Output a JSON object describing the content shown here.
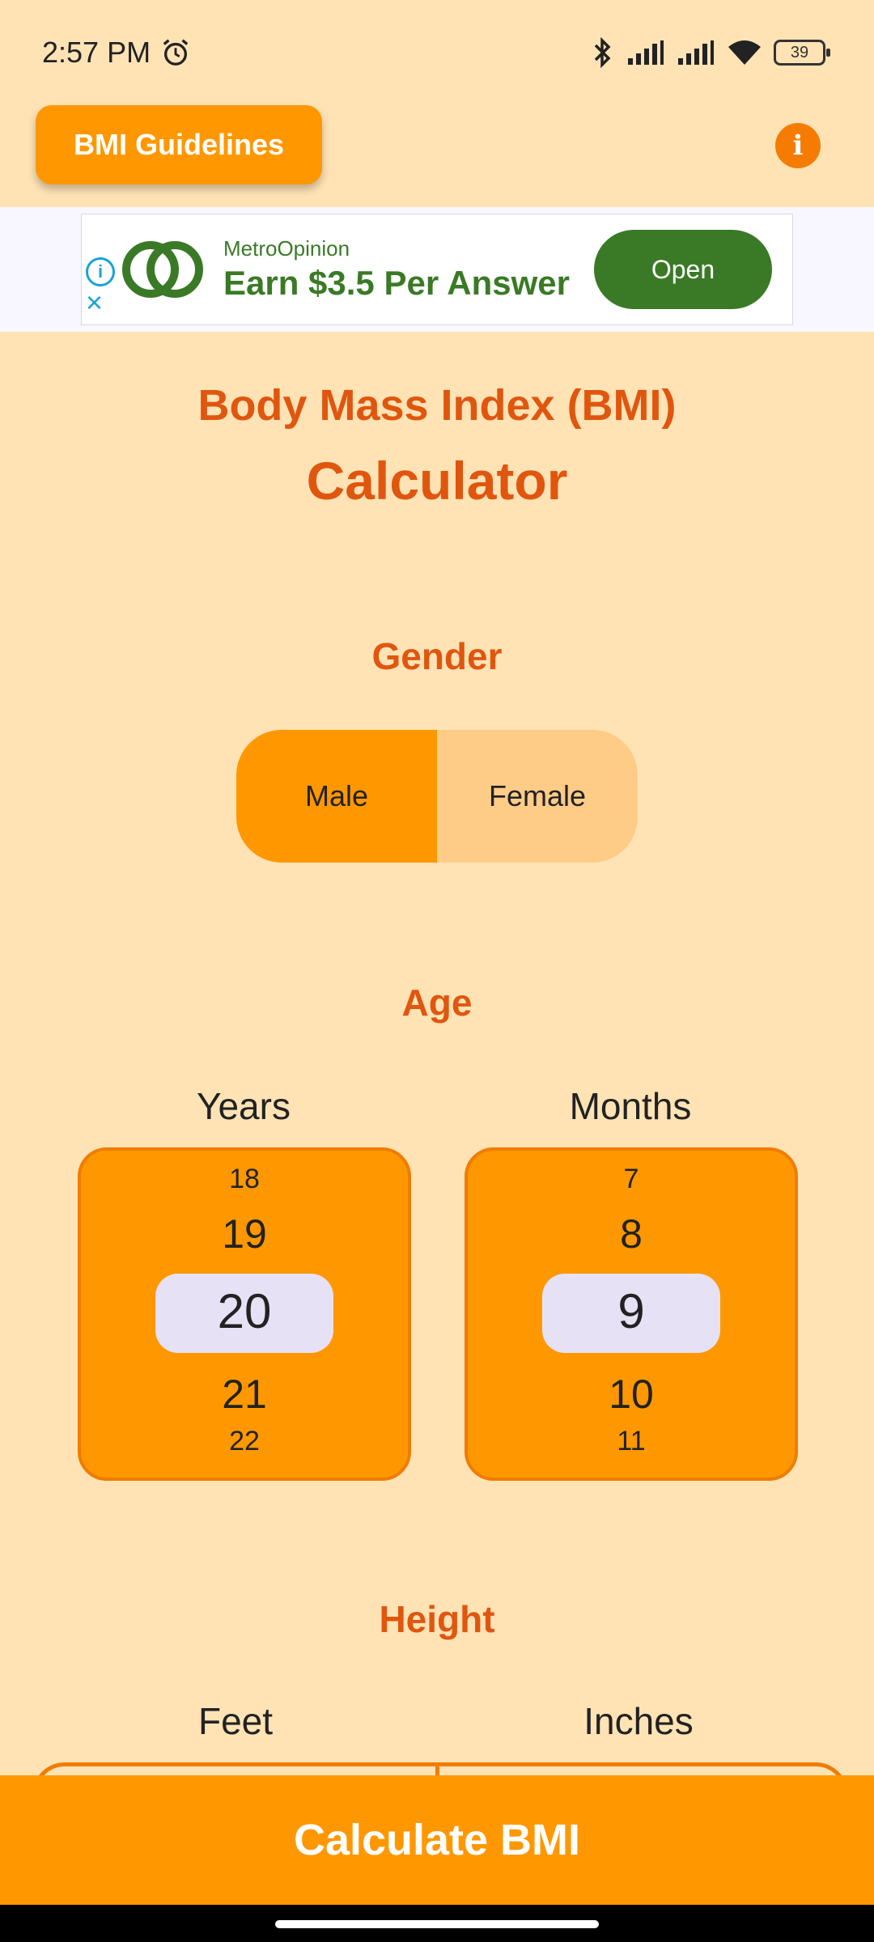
{
  "status_bar": {
    "time": "2:57 PM",
    "battery": "39"
  },
  "header": {
    "guidelines_label": "BMI Guidelines",
    "info_icon": "info-icon",
    "accent_color": "#FF9800"
  },
  "ad": {
    "brand": "MetroOpinion",
    "headline": "Earn $3.5 Per Answer",
    "open_label": "Open"
  },
  "title": {
    "line1": "Body Mass Index (BMI)",
    "line2": "Calculator"
  },
  "gender": {
    "title": "Gender",
    "options": [
      "Male",
      "Female"
    ],
    "selected": "Male"
  },
  "age": {
    "title": "Age",
    "years": {
      "label": "Years",
      "values": [
        "18",
        "19",
        "20",
        "21",
        "22"
      ],
      "selected": "20"
    },
    "months": {
      "label": "Months",
      "values": [
        "7",
        "8",
        "9",
        "10",
        "11"
      ],
      "selected": "9"
    }
  },
  "height": {
    "title": "Height",
    "feet_label": "Feet",
    "inches_label": "Inches"
  },
  "actions": {
    "calculate_label": "Calculate BMI"
  }
}
